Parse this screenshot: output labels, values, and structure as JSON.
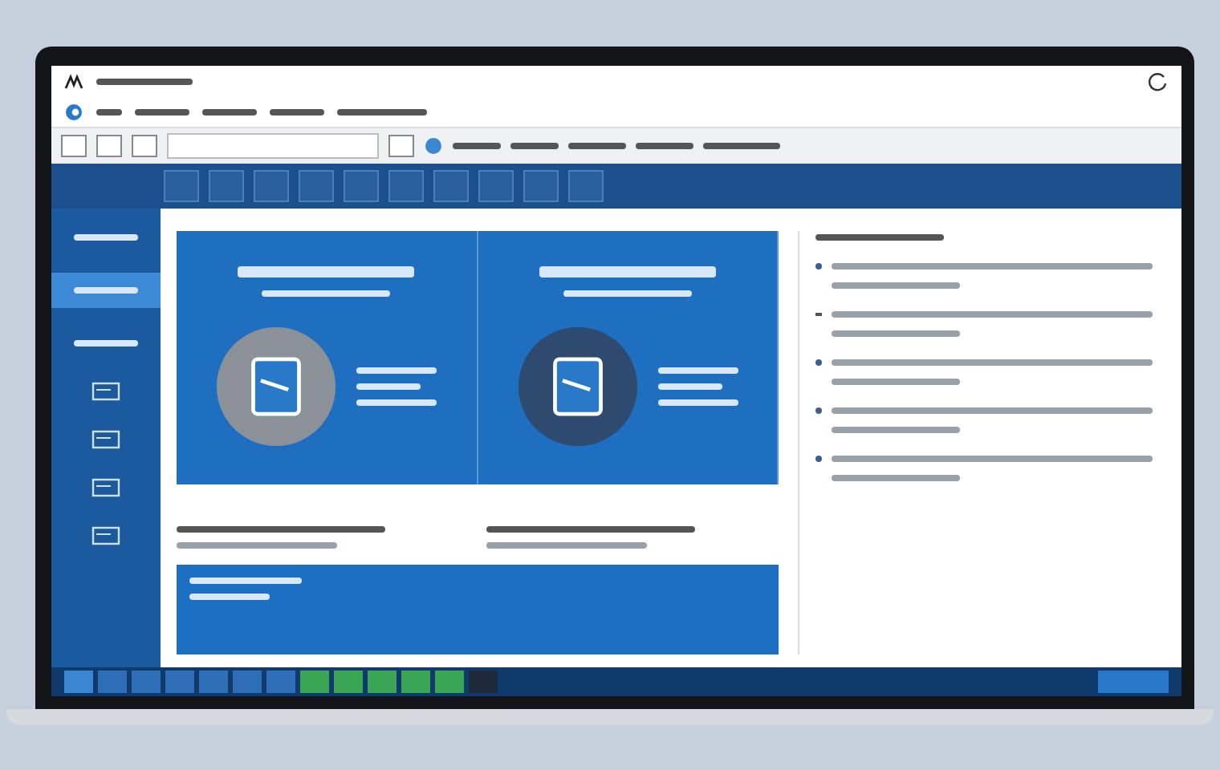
{
  "sidebar": {
    "items": [
      {
        "kind": "label",
        "selected": false
      },
      {
        "kind": "label",
        "selected": true
      },
      {
        "kind": "label",
        "selected": false
      },
      {
        "kind": "icon",
        "selected": false
      },
      {
        "kind": "icon",
        "selected": false
      },
      {
        "kind": "icon",
        "selected": false
      },
      {
        "kind": "icon",
        "selected": false
      }
    ]
  },
  "panels": [
    {
      "kind": "light"
    },
    {
      "kind": "dark"
    }
  ],
  "notes": [
    {
      "kind": "dot"
    },
    {
      "kind": "dash"
    },
    {
      "kind": "dot"
    },
    {
      "kind": "dot"
    },
    {
      "kind": "dot"
    }
  ],
  "taskbar": {
    "items": [
      {
        "color": "#3a86d0"
      },
      {
        "color": "#2f6fb8"
      },
      {
        "color": "#2f6fb8"
      },
      {
        "color": "#2f6fb8"
      },
      {
        "color": "#2f6fb8"
      },
      {
        "color": "#2f6fb8"
      },
      {
        "color": "#2f6fb8"
      },
      {
        "color": "#3aa655"
      },
      {
        "color": "#3aa655"
      },
      {
        "color": "#3aa655"
      },
      {
        "color": "#3aa655"
      },
      {
        "color": "#3aa655"
      },
      {
        "color": "#1e2a3a"
      }
    ]
  }
}
